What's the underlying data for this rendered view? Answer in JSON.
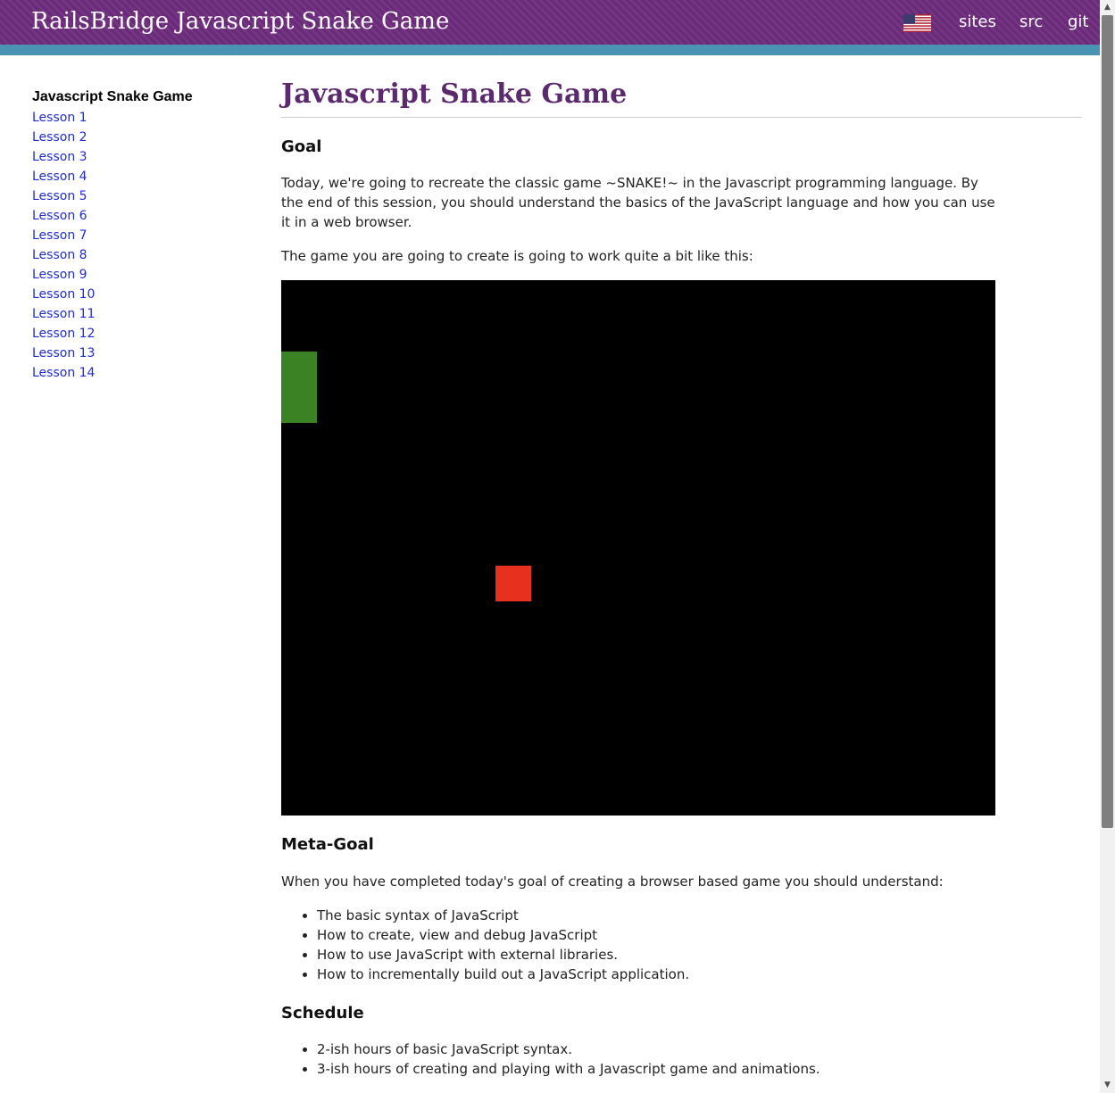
{
  "header": {
    "site_title": "RailsBridge Javascript Snake Game",
    "flag_icon": "us-flag-icon",
    "links": [
      "sites",
      "src",
      "git"
    ],
    "brand_color": "#6b2a7a",
    "accent_color": "#4a93b3"
  },
  "sidebar": {
    "title": "Javascript Snake Game",
    "lessons": [
      "Lesson 1",
      "Lesson 2",
      "Lesson 3",
      "Lesson 4",
      "Lesson 5",
      "Lesson 6",
      "Lesson 7",
      "Lesson 8",
      "Lesson 9",
      "Lesson 10",
      "Lesson 11",
      "Lesson 12",
      "Lesson 13",
      "Lesson 14"
    ]
  },
  "main": {
    "title": "Javascript Snake Game",
    "goal_heading": "Goal",
    "goal_text": "Today, we're going to recreate the classic game ~SNAKE!~ in the Javascript programming language. By the end of this session, you should understand the basics of the JavaScript language and how you can use it in a web browser.",
    "game_intro": "The game you are going to create is going to work quite a bit like this:",
    "game": {
      "snake_color": "#3a8224",
      "apple_color": "#e8301f",
      "background": "#000000"
    },
    "meta_goal_heading": "Meta-Goal",
    "meta_goal_text": "When you have completed today's goal of creating a browser based game you should understand:",
    "meta_goal_items": [
      "The basic syntax of JavaScript",
      "How to create, view and debug JavaScript",
      "How to use JavaScript with external libraries.",
      "How to incrementally build out a JavaScript application."
    ],
    "schedule_heading": "Schedule",
    "schedule_items": [
      "2-ish hours of basic JavaScript syntax.",
      "3-ish hours of creating and playing with a Javascript game and animations."
    ]
  }
}
